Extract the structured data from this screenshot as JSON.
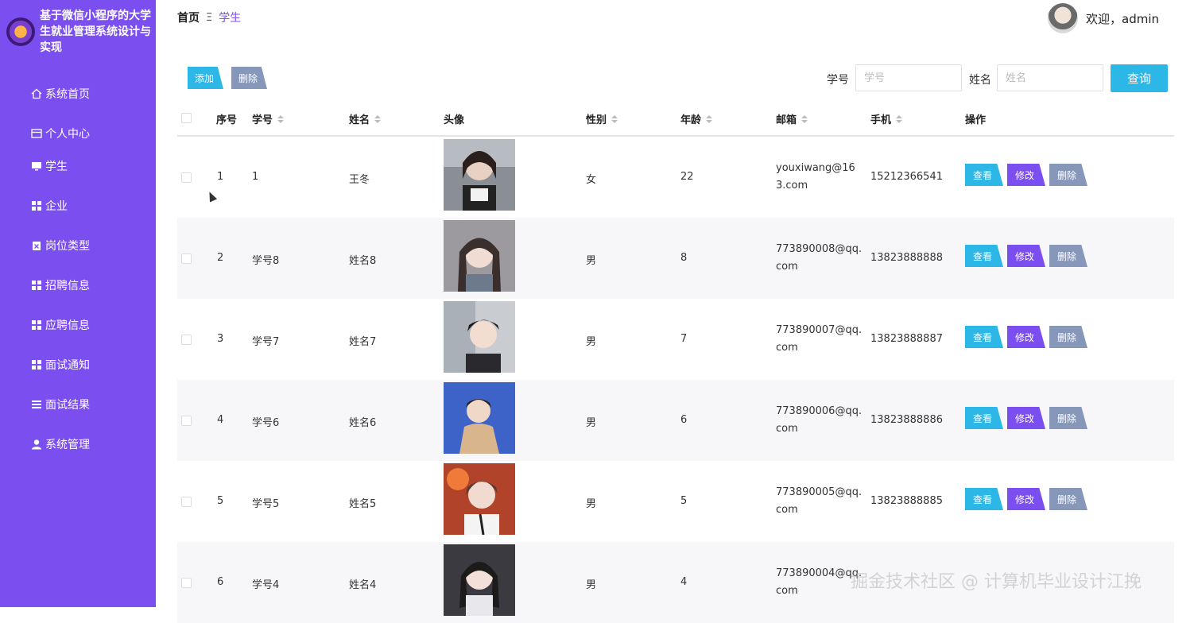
{
  "app": {
    "title": "基于微信小程序的大学生就业管理系统设计与实现"
  },
  "sidebar": {
    "items": [
      {
        "label": "系统首页",
        "icon": "home-icon"
      },
      {
        "label": "个人中心",
        "icon": "card-icon"
      },
      {
        "label": "学生",
        "icon": "monitor-icon"
      },
      {
        "label": "企业",
        "icon": "grid-icon"
      },
      {
        "label": "岗位类型",
        "icon": "clipboard-icon"
      },
      {
        "label": "招聘信息",
        "icon": "grid-icon"
      },
      {
        "label": "应聘信息",
        "icon": "grid-icon"
      },
      {
        "label": "面试通知",
        "icon": "grid-icon"
      },
      {
        "label": "面试结果",
        "icon": "list-icon"
      },
      {
        "label": "系统管理",
        "icon": "user-icon"
      }
    ]
  },
  "header": {
    "breadcrumb_home": "首页",
    "breadcrumb_sep": "Ξ",
    "breadcrumb_current": "学生",
    "welcome": "欢迎，admin"
  },
  "toolbar": {
    "add_label": "添加",
    "delete_label": "删除",
    "filter_id_label": "学号",
    "filter_id_placeholder": "学号",
    "filter_name_label": "姓名",
    "filter_name_placeholder": "姓名",
    "search_label": "查询"
  },
  "table": {
    "headers": {
      "index": "序号",
      "student_id": "学号",
      "name": "姓名",
      "avatar": "头像",
      "gender": "性别",
      "age": "年龄",
      "email": "邮箱",
      "phone": "手机",
      "actions": "操作"
    },
    "rows": [
      {
        "index": "1",
        "student_id": "1",
        "name": "王冬",
        "gender": "女",
        "age": "22",
        "email": "youxiwang@163.com",
        "phone": "15212366541"
      },
      {
        "index": "2",
        "student_id": "学号8",
        "name": "姓名8",
        "gender": "男",
        "age": "8",
        "email": "773890008@qq.com",
        "phone": "13823888888"
      },
      {
        "index": "3",
        "student_id": "学号7",
        "name": "姓名7",
        "gender": "男",
        "age": "7",
        "email": "773890007@qq.com",
        "phone": "13823888887"
      },
      {
        "index": "4",
        "student_id": "学号6",
        "name": "姓名6",
        "gender": "男",
        "age": "6",
        "email": "773890006@qq.com",
        "phone": "13823888886"
      },
      {
        "index": "5",
        "student_id": "学号5",
        "name": "姓名5",
        "gender": "男",
        "age": "5",
        "email": "773890005@qq.com",
        "phone": "13823888885"
      },
      {
        "index": "6",
        "student_id": "学号4",
        "name": "姓名4",
        "gender": "男",
        "age": "4",
        "email": "773890004@qq.com",
        "phone": ""
      }
    ],
    "action_labels": {
      "view": "查看",
      "edit": "修改",
      "delete": "删除"
    }
  },
  "watermark": "掘金技术社区 @ 计算机毕业设计江挽",
  "colors": {
    "sidebar": "#7b4ef0",
    "primary": "#2db7e7",
    "edit": "#7b4ef0",
    "delete": "#8797ba"
  }
}
